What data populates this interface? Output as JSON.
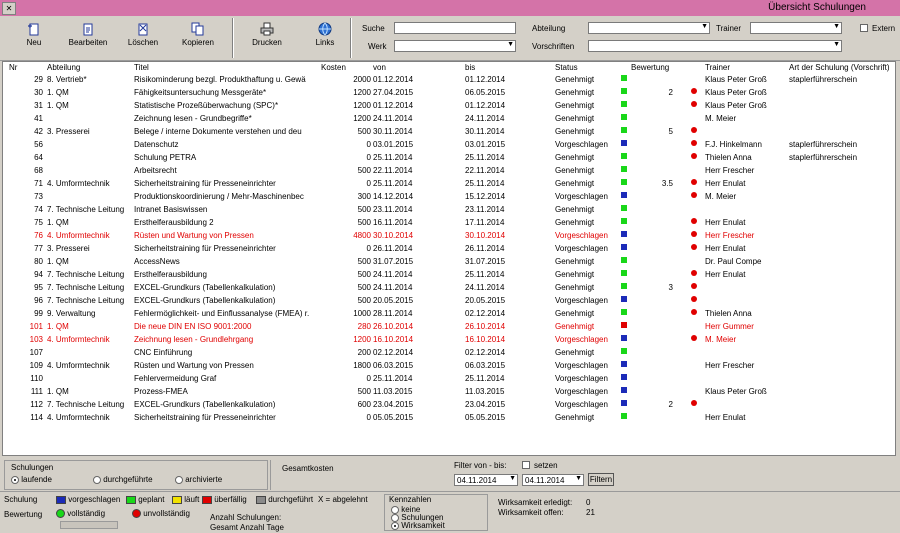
{
  "window": {
    "title": "Übersicht Schulungen"
  },
  "toolbar": {
    "buttons": [
      {
        "label": "Neu",
        "icon": "new-doc-icon"
      },
      {
        "label": "Bearbeiten",
        "icon": "edit-icon"
      },
      {
        "label": "Löschen",
        "icon": "delete-icon"
      },
      {
        "label": "Kopieren",
        "icon": "copy-icon"
      },
      {
        "label": "Drucken",
        "icon": "printer-icon"
      },
      {
        "label": "Links",
        "icon": "globe-icon"
      }
    ],
    "filters": {
      "suche": "Suche",
      "werk": "Werk",
      "abteilung": "Abteilung",
      "trainer": "Trainer",
      "vorschriften": "Vorschriften",
      "extern": "Extern"
    }
  },
  "table": {
    "headers": [
      "Nr",
      "Abteilung",
      "Titel",
      "Kosten",
      "von",
      "bis",
      "Status",
      "Bewertung",
      "Trainer",
      "Art der Schulung (Vorschrift)"
    ],
    "rows": [
      {
        "nr": "29",
        "abt": "8. Vertrieb*",
        "titel": "Risikominderung bezgl. Produkthaftung u. Gewä",
        "kosten": "2000",
        "von": "01.12.2014",
        "bis": "01.12.2014",
        "status": "Genehmigt",
        "sq": "#19d719",
        "bew": "",
        "dot": "",
        "trainer": "Klaus Peter Groß",
        "art": "staplerführerschein",
        "red": false
      },
      {
        "nr": "30",
        "abt": "1. QM",
        "titel": "Fähigkeitsuntersuchung Messgeräte*",
        "kosten": "1200",
        "von": "27.04.2015",
        "bis": "06.05.2015",
        "status": "Genehmigt",
        "sq": "#19d719",
        "bew": "2",
        "dot": "#e00000",
        "trainer": "Klaus Peter Groß",
        "art": "",
        "red": false
      },
      {
        "nr": "31",
        "abt": "1. QM",
        "titel": "Statistische Prozeßüberwachung (SPC)*",
        "kosten": "1200",
        "von": "01.12.2014",
        "bis": "01.12.2014",
        "status": "Genehmigt",
        "sq": "#19d719",
        "bew": "",
        "dot": "#e00000",
        "trainer": "Klaus Peter Groß",
        "art": "",
        "red": false
      },
      {
        "nr": "41",
        "abt": "",
        "titel": "Zeichnung lesen - Grundbegriffe*",
        "kosten": "1200",
        "von": "24.11.2014",
        "bis": "24.11.2014",
        "status": "Genehmigt",
        "sq": "#19d719",
        "bew": "",
        "dot": "",
        "trainer": "M. Meier",
        "art": "",
        "red": false
      },
      {
        "nr": "42",
        "abt": "3. Presserei",
        "titel": "Belege / interne Dokumente verstehen und deu",
        "kosten": "500",
        "von": "30.11.2014",
        "bis": "30.11.2014",
        "status": "Genehmigt",
        "sq": "#19d719",
        "bew": "5",
        "dot": "#e00000",
        "trainer": "",
        "art": "",
        "red": false
      },
      {
        "nr": "56",
        "abt": "",
        "titel": "Datenschutz",
        "kosten": "0",
        "von": "03.01.2015",
        "bis": "03.01.2015",
        "status": "Vorgeschlagen",
        "sq": "#1c2bb8",
        "bew": "",
        "dot": "#e00000",
        "trainer": "F.J. Hinkelmann",
        "art": "staplerführerschein",
        "red": false
      },
      {
        "nr": "64",
        "abt": "",
        "titel": "Schulung PETRA",
        "kosten": "0",
        "von": "25.11.2014",
        "bis": "25.11.2014",
        "status": "Genehmigt",
        "sq": "#19d719",
        "bew": "",
        "dot": "#e00000",
        "trainer": "Thielen Anna",
        "art": "staplerführerschein",
        "red": false
      },
      {
        "nr": "68",
        "abt": "",
        "titel": "Arbeitsrecht",
        "kosten": "500",
        "von": "22.11.2014",
        "bis": "22.11.2014",
        "status": "Genehmigt",
        "sq": "#19d719",
        "bew": "",
        "dot": "",
        "trainer": "Herr Frescher",
        "art": "",
        "red": false
      },
      {
        "nr": "71",
        "abt": "4. Umformtechnik",
        "titel": "Sicherheitstraining für Presseneinrichter",
        "kosten": "0",
        "von": "25.11.2014",
        "bis": "25.11.2014",
        "status": "Genehmigt",
        "sq": "#19d719",
        "bew": "3.5",
        "dot": "#e00000",
        "trainer": "Herr Enulat",
        "art": "",
        "red": false
      },
      {
        "nr": "73",
        "abt": "",
        "titel": "Produktionskoordinierung / Mehr-Maschinenbec",
        "kosten": "300",
        "von": "14.12.2014",
        "bis": "15.12.2014",
        "status": "Vorgeschlagen",
        "sq": "#1c2bb8",
        "bew": "",
        "dot": "#e00000",
        "trainer": "M. Meier",
        "art": "",
        "red": false
      },
      {
        "nr": "74",
        "abt": "7. Technische Leitung",
        "titel": "Intranet Basiswissen",
        "kosten": "500",
        "von": "23.11.2014",
        "bis": "23.11.2014",
        "status": "Genehmigt",
        "sq": "#19d719",
        "bew": "",
        "dot": "",
        "trainer": "",
        "art": "",
        "red": false
      },
      {
        "nr": "75",
        "abt": "1. QM",
        "titel": "Ersthelferausbildung 2",
        "kosten": "500",
        "von": "16.11.2014",
        "bis": "17.11.2014",
        "status": "Genehmigt",
        "sq": "#19d719",
        "bew": "",
        "dot": "#e00000",
        "trainer": "Herr Enulat",
        "art": "",
        "red": false
      },
      {
        "nr": "76",
        "abt": "4. Umformtechnik",
        "titel": "Rüsten und Wartung von Pressen",
        "kosten": "4800",
        "von": "30.10.2014",
        "bis": "30.10.2014",
        "status": "Vorgeschlagen",
        "sq": "#1c2bb8",
        "bew": "",
        "dot": "#e00000",
        "trainer": "Herr Frescher",
        "art": "",
        "red": true
      },
      {
        "nr": "77",
        "abt": "3. Presserei",
        "titel": "Sicherheitstraining für Presseneinrichter",
        "kosten": "0",
        "von": "26.11.2014",
        "bis": "26.11.2014",
        "status": "Vorgeschlagen",
        "sq": "#1c2bb8",
        "bew": "",
        "dot": "#e00000",
        "trainer": "Herr Enulat",
        "art": "",
        "red": false
      },
      {
        "nr": "80",
        "abt": "1. QM",
        "titel": "AccessNews",
        "kosten": "500",
        "von": "31.07.2015",
        "bis": "31.07.2015",
        "status": "Genehmigt",
        "sq": "#19d719",
        "bew": "",
        "dot": "",
        "trainer": "Dr. Paul Compe",
        "art": "",
        "red": false
      },
      {
        "nr": "94",
        "abt": "7. Technische Leitung",
        "titel": "Ersthelferausbildung",
        "kosten": "500",
        "von": "24.11.2014",
        "bis": "25.11.2014",
        "status": "Genehmigt",
        "sq": "#19d719",
        "bew": "",
        "dot": "#e00000",
        "trainer": "Herr Enulat",
        "art": "",
        "red": false
      },
      {
        "nr": "95",
        "abt": "7. Technische Leitung",
        "titel": "EXCEL-Grundkurs (Tabellenkalkulation)",
        "kosten": "500",
        "von": "24.11.2014",
        "bis": "24.11.2014",
        "status": "Genehmigt",
        "sq": "#19d719",
        "bew": "3",
        "dot": "#e00000",
        "trainer": "",
        "art": "",
        "red": false
      },
      {
        "nr": "96",
        "abt": "7. Technische Leitung",
        "titel": "EXCEL-Grundkurs (Tabellenkalkulation)",
        "kosten": "500",
        "von": "20.05.2015",
        "bis": "20.05.2015",
        "status": "Vorgeschlagen",
        "sq": "#1c2bb8",
        "bew": "",
        "dot": "#e00000",
        "trainer": "",
        "art": "",
        "red": false
      },
      {
        "nr": "99",
        "abt": "9. Verwaltung",
        "titel": "Fehlermöglichkeit- und Einflussanalyse (FMEA) r.",
        "kosten": "1000",
        "von": "28.11.2014",
        "bis": "02.12.2014",
        "status": "Genehmigt",
        "sq": "#19d719",
        "bew": "",
        "dot": "#e00000",
        "trainer": "Thielen Anna",
        "art": "",
        "red": false
      },
      {
        "nr": "101",
        "abt": "1. QM",
        "titel": "Die neue DIN EN ISO 9001:2000",
        "kosten": "280",
        "von": "26.10.2014",
        "bis": "26.10.2014",
        "status": "Genehmigt",
        "sq": "#e00000",
        "bew": "",
        "dot": "",
        "trainer": "Herr Gummer",
        "art": "",
        "red": true
      },
      {
        "nr": "103",
        "abt": "4. Umformtechnik",
        "titel": "Zeichnung lesen - Grundlehrgang",
        "kosten": "1200",
        "von": "16.10.2014",
        "bis": "16.10.2014",
        "status": "Vorgeschlagen",
        "sq": "#1c2bb8",
        "bew": "",
        "dot": "#e00000",
        "trainer": "M. Meier",
        "art": "",
        "red": true
      },
      {
        "nr": "107",
        "abt": "",
        "titel": "CNC Einführung",
        "kosten": "200",
        "von": "02.12.2014",
        "bis": "02.12.2014",
        "status": "Genehmigt",
        "sq": "#19d719",
        "bew": "",
        "dot": "",
        "trainer": "",
        "art": "",
        "red": false
      },
      {
        "nr": "109",
        "abt": "4. Umformtechnik",
        "titel": "Rüsten und Wartung von Pressen",
        "kosten": "1800",
        "von": "06.03.2015",
        "bis": "06.03.2015",
        "status": "Vorgeschlagen",
        "sq": "#1c2bb8",
        "bew": "",
        "dot": "",
        "trainer": "Herr Frescher",
        "art": "",
        "red": false
      },
      {
        "nr": "110",
        "abt": "",
        "titel": "Fehlervermeidung Graf",
        "kosten": "0",
        "von": "25.11.2014",
        "bis": "25.11.2014",
        "status": "Vorgeschlagen",
        "sq": "#1c2bb8",
        "bew": "",
        "dot": "",
        "trainer": "",
        "art": "",
        "red": false
      },
      {
        "nr": "111",
        "abt": "1. QM",
        "titel": "Prozess-FMEA",
        "kosten": "500",
        "von": "11.03.2015",
        "bis": "11.03.2015",
        "status": "Vorgeschlagen",
        "sq": "#1c2bb8",
        "bew": "",
        "dot": "",
        "trainer": "Klaus Peter Groß",
        "art": "",
        "red": false
      },
      {
        "nr": "112",
        "abt": "7. Technische Leitung",
        "titel": "EXCEL-Grundkurs (Tabellenkalkulation)",
        "kosten": "600",
        "von": "23.04.2015",
        "bis": "23.04.2015",
        "status": "Vorgeschlagen",
        "sq": "#1c2bb8",
        "bew": "2",
        "dot": "#e00000",
        "trainer": "",
        "art": "",
        "red": false
      },
      {
        "nr": "114",
        "abt": "4. Umformtechnik",
        "titel": "Sicherheitstraining für Presseneinrichter",
        "kosten": "0",
        "von": "05.05.2015",
        "bis": "05.05.2015",
        "status": "Genehmigt",
        "sq": "#19d719",
        "bew": "",
        "dot": "",
        "trainer": "Herr Enulat",
        "art": "",
        "red": false
      }
    ]
  },
  "bottom": {
    "schulungen_label": "Schulungen",
    "radio_laufende": "laufende",
    "radio_durchgefuehrte": "durchgeführte",
    "radio_archivierte": "archivierte",
    "gesamtkosten_label": "Gesamtkosten",
    "filter_label": "Filter von - bis:",
    "filter_from": "04.11.2014",
    "filter_to": "04.11.2014",
    "setzen_label": "setzen",
    "filtern_button": "Filtern",
    "legend_schulung_label": "Schulung",
    "legend_vorgeschlagen": "vorgeschlagen",
    "legend_geplant": "geplant",
    "legend_laeuft": "läuft",
    "legend_ueberfaellig": "überfällig",
    "legend_durchgefuehrt": "durchgeführt",
    "legend_x_abgelehnt": "X = abgelehnt",
    "legend_bewertung_label": "Bewertung",
    "legend_vollstaendig": "vollständig",
    "legend_unvollstaendig": "unvollständig",
    "anzahl_label": "Anzahl Schulungen:",
    "gesamt_label": "Gesamt",
    "anzahl_tage_label": "Anzahl Tage",
    "kennzahlen_label": "Kennzahlen",
    "kz_keine": "keine",
    "kz_schulungen": "Schulungen",
    "kz_wirksamkeit": "Wirksamkeit",
    "wirk_erledigt_label": "Wirksamkeit erledigt:",
    "wirk_erledigt_value": "0",
    "wirk_offen_label": "Wirksamkeit offen:",
    "wirk_offen_value": "21"
  },
  "colors": {
    "green": "#19d719",
    "blue": "#1c2bb8",
    "yellow": "#f2e200",
    "red": "#e00000",
    "gray": "#8a8a8a",
    "title_bar": "#d473a8"
  }
}
